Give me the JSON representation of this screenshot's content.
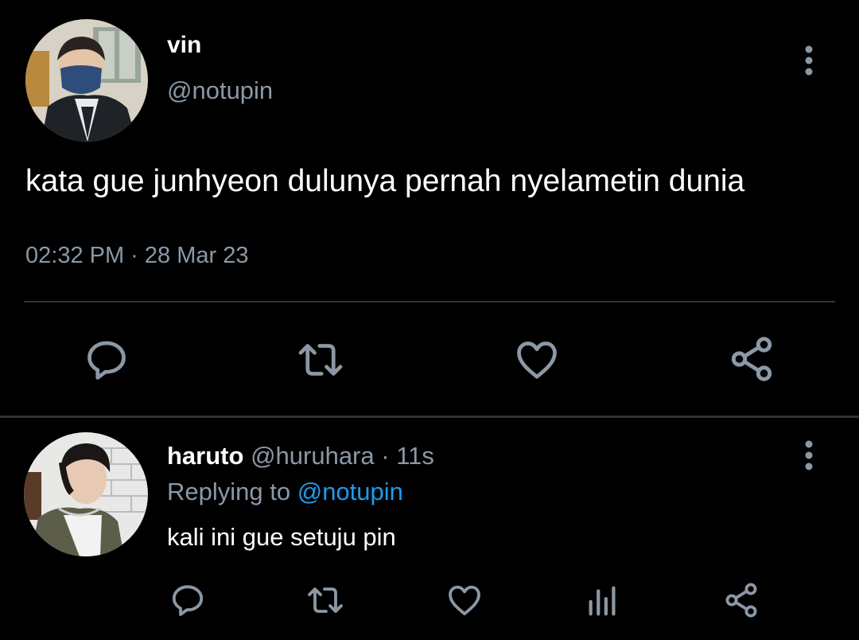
{
  "main_tweet": {
    "display_name": "vin",
    "handle": "@notupin",
    "text": "kata gue junhyeon dulunya pernah nyelametin dunia",
    "timestamp": "02:32 PM · 28 Mar 23",
    "actions": [
      "reply-icon",
      "retweet-icon",
      "like-icon",
      "share-icon"
    ]
  },
  "reply": {
    "display_name": "haruto",
    "handle": "@huruhara",
    "separator": "·",
    "time": "11s",
    "replying_prefix": "Replying to",
    "replying_to": "@notupin",
    "text": "kali ini gue setuju pin",
    "actions": [
      "reply-icon",
      "retweet-icon",
      "like-icon",
      "analytics-icon",
      "share-icon"
    ]
  },
  "colors": {
    "background": "#000000",
    "primary_text": "#ffffff",
    "secondary_text": "#8b98a5",
    "link": "#1d9bf0",
    "divider": "#2f3336",
    "icon": "#8b98a5"
  }
}
